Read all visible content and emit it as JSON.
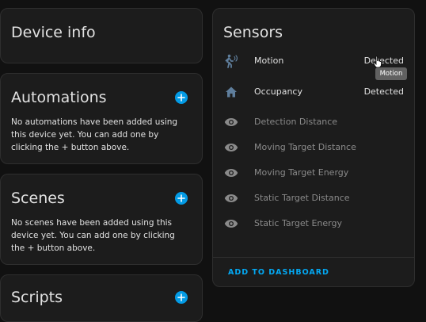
{
  "device_info": {
    "title": "Device info"
  },
  "automations": {
    "title": "Automations",
    "empty_text": "No automations have been added using this device yet. You can add one by clicking the + button above."
  },
  "scenes": {
    "title": "Scenes",
    "empty_text": "No scenes have been added using this device yet. You can add one by clicking the + button above."
  },
  "scripts": {
    "title": "Scripts"
  },
  "sensors": {
    "title": "Sensors",
    "items": [
      {
        "name": "Motion",
        "value": "Detected",
        "icon": "motion-sensor-icon",
        "dim": false
      },
      {
        "name": "Occupancy",
        "value": "Detected",
        "icon": "home-icon",
        "dim": false
      },
      {
        "name": "Detection Distance",
        "value": "",
        "icon": "eye-icon",
        "dim": true
      },
      {
        "name": "Moving Target Distance",
        "value": "",
        "icon": "eye-icon",
        "dim": true
      },
      {
        "name": "Moving Target Energy",
        "value": "",
        "icon": "eye-icon",
        "dim": true
      },
      {
        "name": "Static Target Distance",
        "value": "",
        "icon": "eye-icon",
        "dim": true
      },
      {
        "name": "Static Target Energy",
        "value": "",
        "icon": "eye-icon",
        "dim": true
      }
    ],
    "action_label": "ADD TO DASHBOARD"
  },
  "tooltip": {
    "text": "Motion"
  },
  "colors": {
    "accent": "#039be5",
    "icon": "#5f7e9c",
    "dim_icon": "#8a8a8a",
    "link": "#03a9f4"
  }
}
